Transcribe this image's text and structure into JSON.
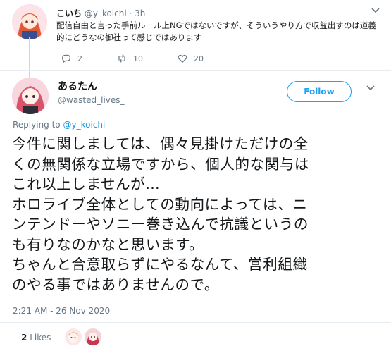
{
  "reply": {
    "name": "こいち",
    "handle": "@y_koichi",
    "separator": "·",
    "time": "3h",
    "text": "配信自由と言った手前ルール上NGではないですが、そういうやり方で収益出すのは道義的にどうなの御社って感じではあります",
    "replies_count": "2",
    "retweets_count": "10",
    "likes_count": "20"
  },
  "main": {
    "name": "あるたん",
    "handle": "@wasted_lives_",
    "follow_label": "Follow",
    "replying_prefix": "Replying to",
    "replying_handle": "@y_koichi",
    "body_lines": [
      "今件に関しましては、偶々見掛けただけの全",
      "くの無関係な立場ですから、個人的な関与は",
      "これ以上しませんが…",
      "ホロライブ全体としての動向によっては、ニ",
      "ンテンドーやソニー巻き込んで抗議というの",
      "も有りなのかなと思います。",
      "ちゃんと合意取らずにやるなんて、営利組織",
      "のやる事ではありませんので。"
    ],
    "timestamp": "2:21 AM - 26 Nov 2020",
    "likes_count": "2",
    "likes_label": "Likes"
  },
  "icons": {
    "reply": "reply-icon",
    "retweet": "retweet-icon",
    "like": "heart-icon",
    "caret": "chevron-down-icon"
  },
  "colors": {
    "accent": "#1da1f2",
    "secondary_text": "#657786",
    "divider": "#e6ecf0"
  }
}
